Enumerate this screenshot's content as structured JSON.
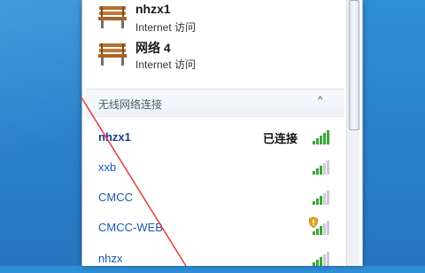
{
  "connections": [
    {
      "name": "nhzx1",
      "subtitle": "Internet 访问",
      "icon": "network-bench-icon"
    },
    {
      "name": "网络  4",
      "subtitle": "Internet 访问",
      "icon": "network-bench-icon"
    }
  ],
  "wireless_section": {
    "title": "无线网络连接",
    "chevron": "^"
  },
  "networks": [
    {
      "name": "nhzx1",
      "status": "已连接",
      "signal_level": 5,
      "secured_warning": false,
      "connected": true
    },
    {
      "name": "xxb",
      "status": "",
      "signal_level": 3,
      "secured_warning": false,
      "connected": false
    },
    {
      "name": "CMCC",
      "status": "",
      "signal_level": 3,
      "secured_warning": false,
      "connected": false
    },
    {
      "name": "CMCC-WEB",
      "status": "",
      "signal_level": 3,
      "secured_warning": true,
      "connected": false
    },
    {
      "name": "nhzx",
      "status": "",
      "signal_level": 3,
      "secured_warning": false,
      "connected": false
    }
  ],
  "colors": {
    "desktop": "#2a7fc9",
    "link": "#1a59b7",
    "signal_active": "#3aa635",
    "signal_inactive": "#c9ccd1",
    "annotation": "#e23b3b"
  }
}
